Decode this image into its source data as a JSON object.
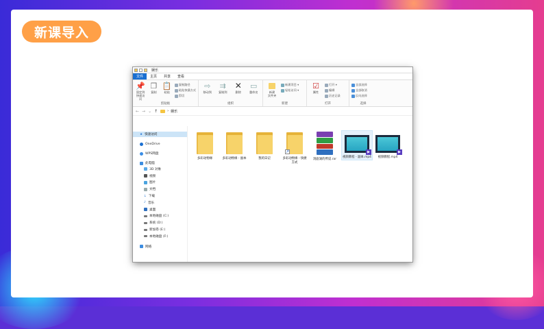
{
  "slide": {
    "title": "新课导入"
  },
  "window": {
    "title": "娱乐",
    "tabs": [
      "文件",
      "主页",
      "共享",
      "查看"
    ],
    "ribbon": {
      "clipboard": {
        "label": "剪贴板",
        "pin": "固定到快速访问",
        "copy": "复制",
        "paste": "粘贴",
        "small": [
          "复制路径",
          "粘贴快捷方式",
          "剪切"
        ]
      },
      "organize": {
        "label": "组织",
        "move": "移动到",
        "copyto": "复制到",
        "delete": "删除",
        "rename": "重命名"
      },
      "new": {
        "label": "新建",
        "new_folder": "新建\n文件夹",
        "small": [
          "新建项目 ▾",
          "轻松访问 ▾"
        ]
      },
      "open": {
        "label": "打开",
        "props": "属性",
        "small": [
          "打开 ▾",
          "编辑",
          "历史记录"
        ]
      },
      "select": {
        "label": "选择",
        "small": [
          "全部选择",
          "全部取消",
          "反向选择"
        ]
      }
    },
    "address": {
      "path": "娱乐"
    },
    "nav": {
      "quick": "快速访问",
      "onedrive": "OneDrive",
      "wps": "WPS网盘",
      "pc": "此电脑",
      "items": [
        "3D 对象",
        "视频",
        "图片",
        "文档",
        "下载",
        "音乐",
        "桌面",
        "本地磁盘 (C:)",
        "系统 (D:)",
        "新加卷 (E:)",
        "本地磁盘 (F:)"
      ],
      "network": "网络"
    },
    "files": [
      {
        "name": "多彩动物缘",
        "type": "folder"
      },
      {
        "name": "多彩动物缘 - 副本",
        "type": "folder"
      },
      {
        "name": "我的日记",
        "type": "folder"
      },
      {
        "name": "多彩动物缘 - 快捷方式",
        "type": "shortcut"
      },
      {
        "name": "洞庭湖的传说.rar",
        "type": "rar"
      },
      {
        "name": "视频教程 - 副本.mp4",
        "type": "video",
        "selected": true
      },
      {
        "name": "视频教程.mp4",
        "type": "video"
      }
    ]
  },
  "colors": {
    "accent": "#ffa047",
    "file_tab": "#1a6fd1"
  }
}
